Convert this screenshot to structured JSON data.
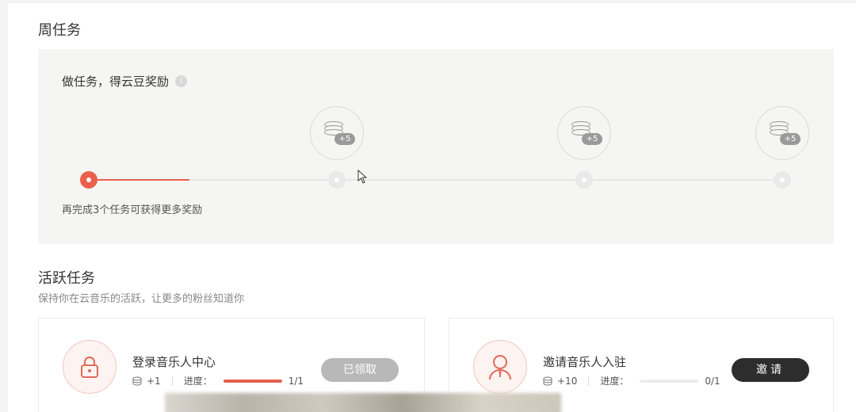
{
  "weekly": {
    "title": "周任务",
    "heading": "做任务，得云豆奖励",
    "info_icon": "info-icon",
    "hint": "再完成3个任务可获得更多奖励",
    "progress_fraction": 0.145,
    "rewards": [
      {
        "label": "+5",
        "icon": "coin-stack-icon"
      },
      {
        "label": "+5",
        "icon": "coin-stack-icon"
      },
      {
        "label": "+5",
        "icon": "coin-stack-icon"
      }
    ],
    "accent_color": "#ec5f4d"
  },
  "active": {
    "title": "活跃任务",
    "subtitle": "保持你在云音乐的活跃，让更多的粉丝知道你",
    "tasks": [
      {
        "name": "登录音乐人中心",
        "icon": "lock-icon",
        "reward": "+1",
        "progress_label": "进度：",
        "progress_text": "1/1",
        "progress_fraction": 1,
        "button": "已领取"
      },
      {
        "name": "邀请音乐人入驻",
        "icon": "user-icon",
        "reward": "+10",
        "progress_label": "进度：",
        "progress_text": "0/1",
        "progress_fraction": 0,
        "button": "邀请"
      }
    ]
  }
}
